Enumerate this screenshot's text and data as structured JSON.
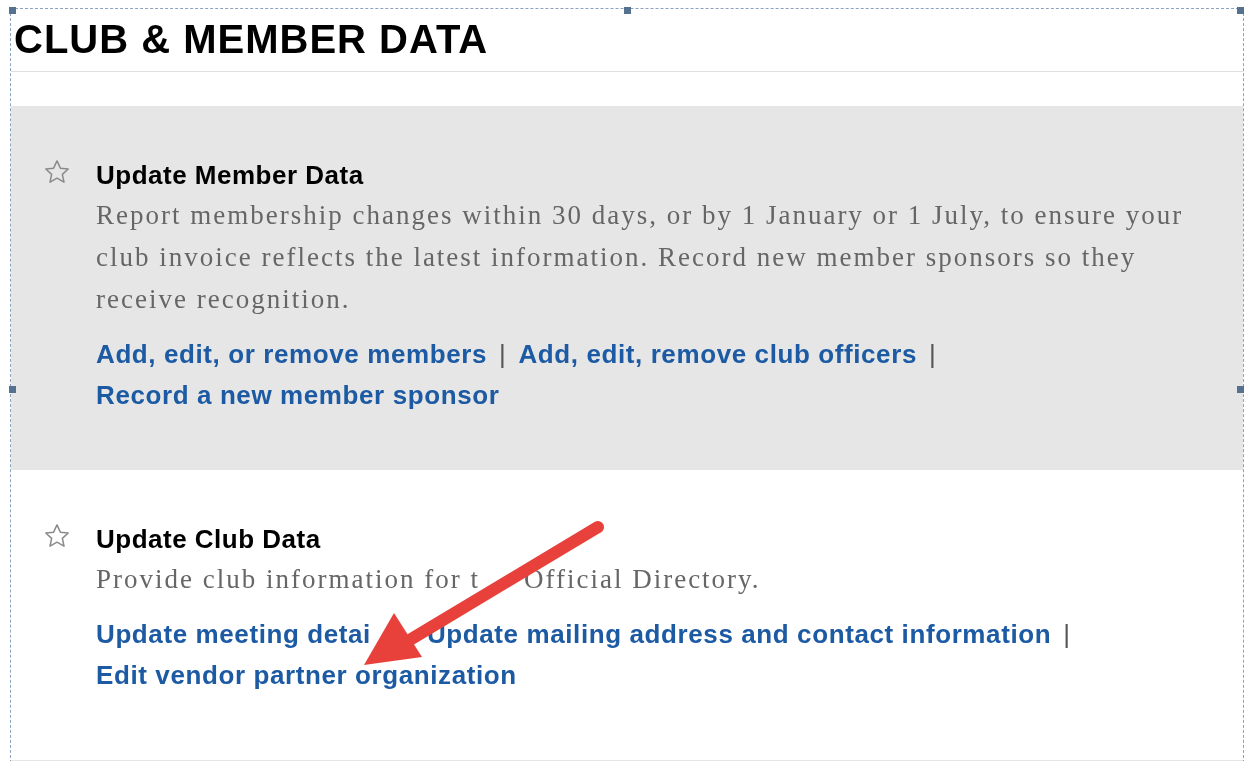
{
  "title": "CLUB & MEMBER DATA",
  "sections": [
    {
      "heading": "Update Member Data",
      "highlighted": true,
      "description": [
        {
          "kind": "text",
          "text": "Report membership changes within 30 days, or by 1 January or 1 July, to ensure your club invoice reflects the latest information. Record new member sponsors so they receive recognition."
        }
      ],
      "links": [
        {
          "kind": "link",
          "text": "Add, edit, or remove members"
        },
        {
          "kind": "separator",
          "text": "|"
        },
        {
          "kind": "link",
          "text": "Add, edit, remove club officers"
        },
        {
          "kind": "separator",
          "text": "|"
        },
        {
          "kind": "break"
        },
        {
          "kind": "link",
          "text": "Record a new member sponsor"
        }
      ]
    },
    {
      "heading": "Update Club Data",
      "highlighted": false,
      "description": [
        {
          "kind": "text",
          "text": "Provide club information for t"
        },
        {
          "kind": "covered"
        },
        {
          "kind": "text",
          "text": "Official Directory."
        }
      ],
      "links": [
        {
          "kind": "link",
          "text": "Update meeting detai"
        },
        {
          "kind": "covered"
        },
        {
          "kind": "link",
          "text": "Update mailing address and contact information"
        },
        {
          "kind": "separator",
          "text": "|"
        },
        {
          "kind": "break"
        },
        {
          "kind": "link",
          "text": "Edit vendor partner organization"
        }
      ]
    }
  ]
}
